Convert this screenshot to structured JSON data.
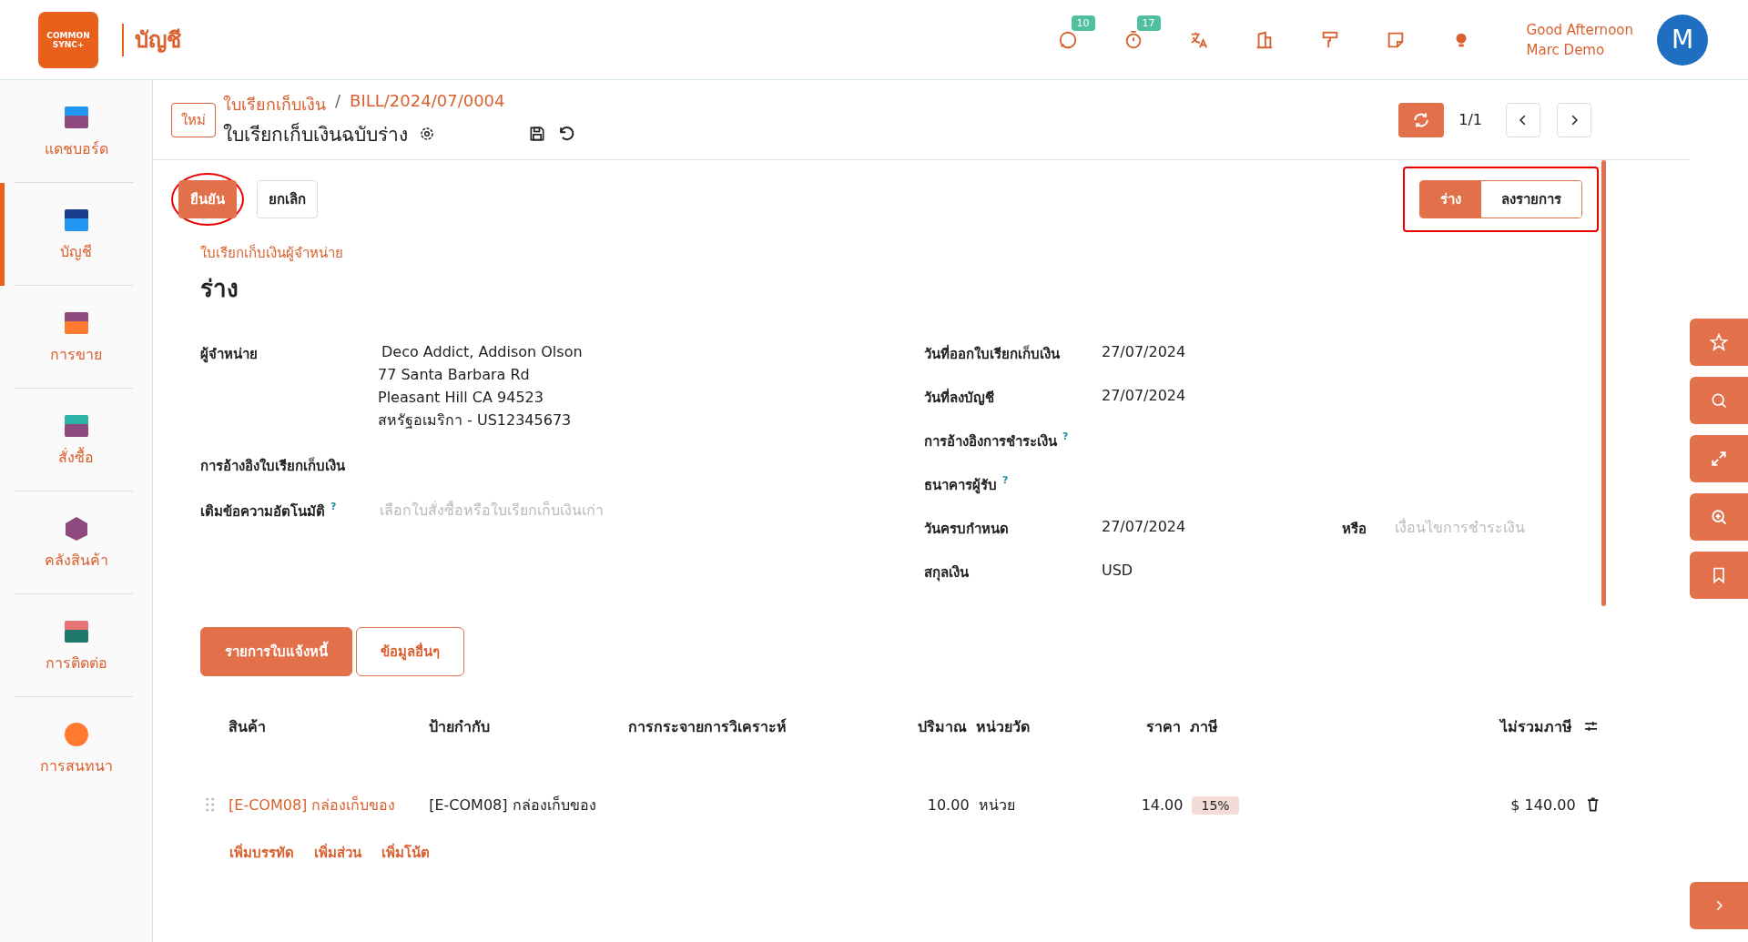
{
  "logo": {
    "lines": [
      "COMMON",
      "SYNC+"
    ]
  },
  "app_title": "บัญชี",
  "topbar": {
    "icons": [
      {
        "kind": "chat",
        "badge": "10"
      },
      {
        "kind": "timer",
        "badge": "17"
      },
      {
        "kind": "translate"
      },
      {
        "kind": "building"
      },
      {
        "kind": "paint"
      },
      {
        "kind": "note"
      },
      {
        "kind": "bulb"
      }
    ],
    "greeting": "Good Afternoon",
    "user": "Marc Demo",
    "avatar": "M"
  },
  "sidebar": {
    "items": [
      {
        "label": "แดชบอร์ด",
        "kind": "dashboard",
        "selected": false
      },
      {
        "label": "บัญชี",
        "kind": "accounting",
        "selected": true
      },
      {
        "label": "การขาย",
        "kind": "sales",
        "selected": false
      },
      {
        "label": "สั่งซื้อ",
        "kind": "purchase",
        "selected": false
      },
      {
        "label": "คลังสินค้า",
        "kind": "inventory",
        "selected": false
      },
      {
        "label": "การติดต่อ",
        "kind": "contacts",
        "selected": false
      },
      {
        "label": "การสนทนา",
        "kind": "discuss",
        "selected": false
      }
    ]
  },
  "header": {
    "new_button": "ใหม่",
    "breadcrumb": "ใบเรียกเก็บเงิน",
    "separator": "/",
    "record": "BILL/2024/07/0004",
    "title": "ใบเรียกเก็บเงินฉบับร่าง",
    "pager": "1/1"
  },
  "actions": [
    {
      "label": "ยืนยัน",
      "primary": true,
      "highlighted": true
    },
    {
      "label": "ยกเลิก",
      "primary": false,
      "highlighted": false
    }
  ],
  "status": {
    "highlighted": true,
    "stages": [
      {
        "label": "ร่าง",
        "selected": true
      },
      {
        "label": "ลงรายการ",
        "selected": false
      }
    ]
  },
  "form": {
    "type_label": "ใบเรียกเก็บเงินผู้จำหน่าย",
    "state_title": "ร่าง",
    "left_fields": [
      {
        "label": "ผู้จำหน่าย",
        "value_lines": [
          "Deco Addict, Addison Olson",
          "77 Santa Barbara Rd",
          "Pleasant Hill CA 94523",
          "สหรัฐอเมริกา - US12345673"
        ]
      },
      {
        "label": "การอ้างอิงใบเรียกเก็บเงิน"
      },
      {
        "label": "เติมข้อความอัตโนมัติ",
        "help_mark": "?",
        "placeholder": "เลือกใบสั่งซื้อหรือใบเรียกเก็บเงินเก่า"
      }
    ],
    "right_fields": [
      {
        "label": "วันที่ออกใบเรียกเก็บเงิน",
        "value": "27/07/2024"
      },
      {
        "label": "วันที่ลงบัญชี",
        "value": "27/07/2024"
      },
      {
        "label": "การอ้างอิงการชำระเงิน",
        "help_mark": "?"
      },
      {
        "label": "ธนาคารผู้รับ",
        "help_mark": "?"
      },
      {
        "label": "วันครบกำหนด",
        "value": "27/07/2024",
        "or_label": "หรือ",
        "or_placeholder": "เงื่อนไขการชำระเงิน"
      },
      {
        "label": "สกุลเงิน",
        "value": "USD"
      }
    ]
  },
  "tabs": [
    {
      "label": "รายการใบแจ้งหนี้",
      "selected": true
    },
    {
      "label": "ข้อมูลอื่นๆ",
      "selected": false
    }
  ],
  "table": {
    "columns": [
      "สินค้า",
      "ป้ายกำกับ",
      "การกระจายการวิเคราะห์",
      "ปริมาณ",
      "หน่วยวัด",
      "ราคา",
      "ภาษี",
      "ไม่รวมภาษี"
    ],
    "rows": [
      {
        "product": "[E-COM08] กล่องเก็บของ",
        "label": "[E-COM08] กล่องเก็บของ",
        "quantity": "10.00",
        "uom": "หน่วย",
        "price": "14.00",
        "tax": "15%",
        "subtotal": "$ 140.00"
      }
    ],
    "add_links": [
      "เพิ่มบรรทัด",
      "เพิ่มส่วน",
      "เพิ่มโน้ต"
    ]
  },
  "side_tools": [
    {
      "kind": "star"
    },
    {
      "kind": "search"
    },
    {
      "kind": "expand"
    },
    {
      "kind": "zoom"
    },
    {
      "kind": "bookmark"
    }
  ]
}
